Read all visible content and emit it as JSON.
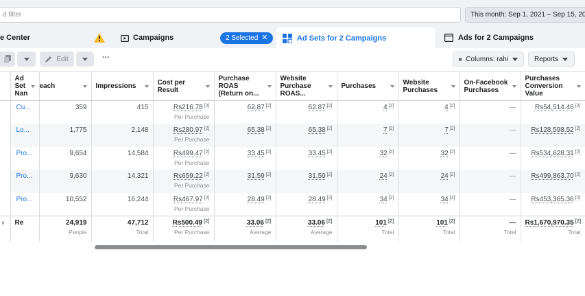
{
  "filter": {
    "placeholder": "d filter"
  },
  "date_range": "This month: Sep 1, 2021 – Sep 15, 2021",
  "tabs": {
    "account": "e Center",
    "campaigns": "Campaigns",
    "selected": "2 Selected",
    "adsets": "Ad Sets for 2 Campaigns",
    "ads": "Ads for 2 Campaigns"
  },
  "toolbar": {
    "edit": "Edit",
    "more": "···",
    "columns": "Columns: rahi",
    "reports": "Reports"
  },
  "columns": [
    "Ad Set Nan",
    "each",
    "Impressions",
    "Cost per Result",
    "Purchase ROAS (Return on...",
    "Website Purchase ROAS...",
    "Purchases",
    "Website Purchases",
    "On-Facebook Purchases",
    "Purchases Conversion Value"
  ],
  "rows": [
    {
      "name": "Cu...",
      "reach": "359",
      "impressions": "415",
      "cpr": "Rs216.78",
      "cpr_sub": "Per Purchase",
      "roas": "62.87",
      "web_roas": "62.87",
      "purchases": "4",
      "web_purchases": "4",
      "fb_purchases": "—",
      "conv_value": "Rs54,514.46"
    },
    {
      "name": "Lo...",
      "reach": "1,775",
      "impressions": "2,148",
      "cpr": "Rs280.97",
      "cpr_sub": "Per Purchase",
      "roas": "65.38",
      "web_roas": "65.38",
      "purchases": "7",
      "web_purchases": "7",
      "fb_purchases": "—",
      "conv_value": "Rs128,598.52"
    },
    {
      "name": "Pro...",
      "reach": "9,654",
      "impressions": "14,584",
      "cpr": "Rs499.47",
      "cpr_sub": "Per Purchase",
      "roas": "33.45",
      "web_roas": "33.45",
      "purchases": "32",
      "web_purchases": "32",
      "fb_purchases": "—",
      "conv_value": "Rs534,628.31"
    },
    {
      "name": "Pro...",
      "reach": "9,630",
      "impressions": "14,321",
      "cpr": "Rs659.22",
      "cpr_sub": "Per Purchase",
      "roas": "31.59",
      "web_roas": "31.59",
      "purchases": "24",
      "web_purchases": "24",
      "fb_purchases": "—",
      "conv_value": "Rs499,863.70"
    },
    {
      "name": "Pro...",
      "reach": "10,552",
      "impressions": "16,244",
      "cpr": "Rs467.97",
      "cpr_sub": "Per Purchase",
      "roas": "28.49",
      "web_roas": "28.49",
      "purchases": "34",
      "web_purchases": "34",
      "fb_purchases": "—",
      "conv_value": "Rs453,365.36"
    }
  ],
  "footnote": "[2]",
  "total": {
    "name": "Re",
    "reach": "24,919",
    "reach_sub": "People",
    "impressions": "47,712",
    "impressions_sub": "Total",
    "cpr": "Rs500.49",
    "cpr_sub": "Per Purchase",
    "roas": "33.06",
    "roas_sub": "Average",
    "web_roas": "33.06",
    "web_roas_sub": "Average",
    "purchases": "101",
    "purchases_sub": "Total",
    "web_purchases": "101",
    "web_purchases_sub": "Total",
    "fb_purchases": "—",
    "fb_purchases_sub": "Total",
    "conv_value": "Rs1,670,970.35",
    "conv_value_sub": "Total"
  },
  "colors": {
    "accent": "#1b74e4",
    "warning": "#f7b928",
    "border": "#dadde1"
  }
}
